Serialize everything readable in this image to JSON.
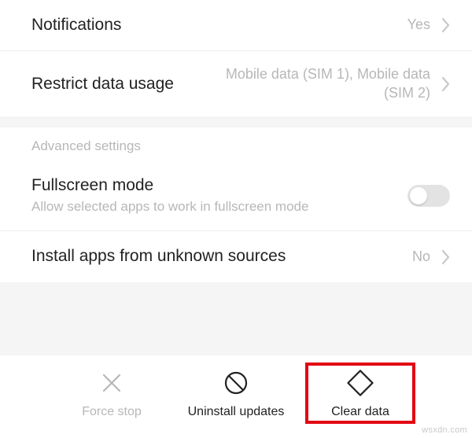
{
  "rows": {
    "notifications": {
      "title": "Notifications",
      "value": "Yes"
    },
    "restrict": {
      "title": "Restrict data usage",
      "value": "Mobile data (SIM 1), Mobile data (SIM 2)"
    },
    "fullscreen": {
      "title": "Fullscreen mode",
      "subtitle": "Allow selected apps to work in fullscreen mode",
      "toggle": false
    },
    "install": {
      "title": "Install apps from unknown sources",
      "value": "No"
    }
  },
  "section": {
    "advanced": "Advanced settings"
  },
  "actions": {
    "force_stop": "Force stop",
    "uninstall": "Uninstall updates",
    "clear": "Clear data"
  },
  "watermark": "wsxdn.com"
}
